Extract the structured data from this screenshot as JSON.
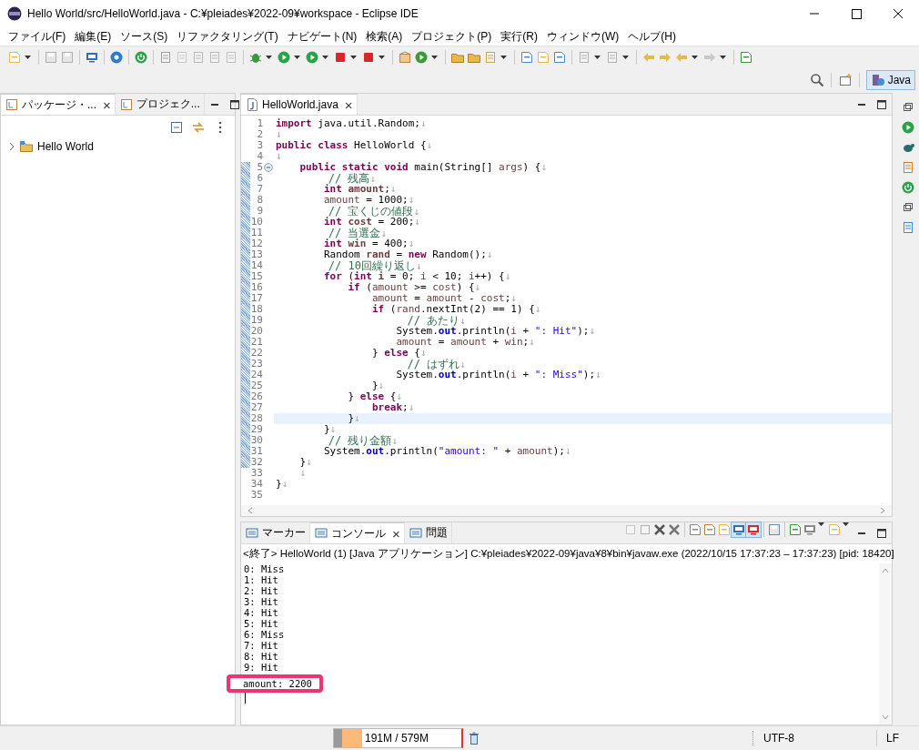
{
  "window": {
    "title": "Hello World/src/HelloWorld.java - C:¥pleiades¥2022-09¥workspace - Eclipse IDE"
  },
  "menu": [
    "ファイル(F)",
    "編集(E)",
    "ソース(S)",
    "リファクタリング(T)",
    "ナビゲート(N)",
    "検索(A)",
    "プロジェクト(P)",
    "実行(R)",
    "ウィンドウ(W)",
    "ヘルプ(H)"
  ],
  "perspective": {
    "label": "Java",
    "selected": true
  },
  "left_panel": {
    "tabs": [
      {
        "label": "パッケージ・...",
        "selected": true,
        "close": "×"
      },
      {
        "label": "プロジェク...",
        "selected": false
      }
    ],
    "tree": [
      {
        "label": "Hello World",
        "expanded": false
      }
    ]
  },
  "editor": {
    "tabs": [
      {
        "label": "HelloWorld.java",
        "selected": true,
        "close": "×"
      }
    ],
    "lines": [
      {
        "number": "1",
        "current": false,
        "changed": false,
        "foldable": false,
        "tokens": [
          {
            "kind": "kw",
            "text": "import"
          },
          {
            "kind": "plain",
            "text": " java.util.Random;"
          },
          {
            "kind": "eol",
            "text": "↓"
          }
        ]
      },
      {
        "number": "2",
        "current": false,
        "changed": false,
        "foldable": false,
        "tokens": [
          {
            "kind": "eol",
            "text": "↓"
          }
        ]
      },
      {
        "number": "3",
        "current": false,
        "changed": false,
        "foldable": false,
        "tokens": [
          {
            "kind": "kw",
            "text": "public class"
          },
          {
            "kind": "plain",
            "text": " HelloWorld {"
          },
          {
            "kind": "eol",
            "text": "↓"
          }
        ]
      },
      {
        "number": "4",
        "current": false,
        "changed": false,
        "foldable": false,
        "tokens": [
          {
            "kind": "eol",
            "text": "↓"
          }
        ]
      },
      {
        "number": "5",
        "current": false,
        "changed": true,
        "foldable": true,
        "tokens": [
          {
            "kind": "kw",
            "text": "    public static void"
          },
          {
            "kind": "plain",
            "text": " main(String[] "
          },
          {
            "kind": "var",
            "text": "args"
          },
          {
            "kind": "plain",
            "text": ") {"
          },
          {
            "kind": "eol",
            "text": "↓"
          }
        ]
      },
      {
        "number": "6",
        "current": false,
        "changed": true,
        "foldable": false,
        "tokens": [
          {
            "kind": "comment",
            "text": "        // 残高"
          },
          {
            "kind": "eol",
            "text": "↓"
          }
        ]
      },
      {
        "number": "7",
        "current": false,
        "changed": true,
        "foldable": false,
        "tokens": [
          {
            "kind": "kw",
            "text": "        int "
          },
          {
            "kind": "decl",
            "text": "amount"
          },
          {
            "kind": "plain",
            "text": ";"
          },
          {
            "kind": "eol",
            "text": "↓"
          }
        ]
      },
      {
        "number": "8",
        "current": false,
        "changed": true,
        "foldable": false,
        "tokens": [
          {
            "kind": "var",
            "text": "        amount"
          },
          {
            "kind": "plain",
            "text": " = 1000;"
          },
          {
            "kind": "eol",
            "text": "↓"
          }
        ]
      },
      {
        "number": "9",
        "current": false,
        "changed": true,
        "foldable": false,
        "tokens": [
          {
            "kind": "comment",
            "text": "        // 宝くじの値段"
          },
          {
            "kind": "eol",
            "text": "↓"
          }
        ]
      },
      {
        "number": "10",
        "current": false,
        "changed": true,
        "foldable": false,
        "tokens": [
          {
            "kind": "kw",
            "text": "        int "
          },
          {
            "kind": "decl",
            "text": "cost"
          },
          {
            "kind": "plain",
            "text": " = 200;"
          },
          {
            "kind": "eol",
            "text": "↓"
          }
        ]
      },
      {
        "number": "11",
        "current": false,
        "changed": true,
        "foldable": false,
        "tokens": [
          {
            "kind": "comment",
            "text": "        // 当選金"
          },
          {
            "kind": "eol",
            "text": "↓"
          }
        ]
      },
      {
        "number": "12",
        "current": false,
        "changed": true,
        "foldable": false,
        "tokens": [
          {
            "kind": "kw",
            "text": "        int "
          },
          {
            "kind": "decl",
            "text": "win"
          },
          {
            "kind": "plain",
            "text": " = 400;"
          },
          {
            "kind": "eol",
            "text": "↓"
          }
        ]
      },
      {
        "number": "13",
        "current": false,
        "changed": true,
        "foldable": false,
        "tokens": [
          {
            "kind": "plain",
            "text": "        Random "
          },
          {
            "kind": "decl",
            "text": "rand"
          },
          {
            "kind": "plain",
            "text": " = "
          },
          {
            "kind": "kw",
            "text": "new"
          },
          {
            "kind": "plain",
            "text": " Random();"
          },
          {
            "kind": "eol",
            "text": "↓"
          }
        ]
      },
      {
        "number": "14",
        "current": false,
        "changed": true,
        "foldable": false,
        "tokens": [
          {
            "kind": "comment",
            "text": "        // 10回繰り返し"
          },
          {
            "kind": "eol",
            "text": "↓"
          }
        ]
      },
      {
        "number": "15",
        "current": false,
        "changed": true,
        "foldable": false,
        "tokens": [
          {
            "kind": "kw",
            "text": "        for"
          },
          {
            "kind": "plain",
            "text": " ("
          },
          {
            "kind": "kw",
            "text": "int "
          },
          {
            "kind": "decl",
            "text": "i"
          },
          {
            "kind": "plain",
            "text": " = 0; "
          },
          {
            "kind": "var",
            "text": "i"
          },
          {
            "kind": "plain",
            "text": " < 10; "
          },
          {
            "kind": "var",
            "text": "i"
          },
          {
            "kind": "plain",
            "text": "++) {"
          },
          {
            "kind": "eol",
            "text": "↓"
          }
        ]
      },
      {
        "number": "16",
        "current": false,
        "changed": true,
        "foldable": false,
        "tokens": [
          {
            "kind": "kw",
            "text": "            if"
          },
          {
            "kind": "plain",
            "text": " ("
          },
          {
            "kind": "var",
            "text": "amount"
          },
          {
            "kind": "plain",
            "text": " >= "
          },
          {
            "kind": "var",
            "text": "cost"
          },
          {
            "kind": "plain",
            "text": ") {"
          },
          {
            "kind": "eol",
            "text": "↓"
          }
        ]
      },
      {
        "number": "17",
        "current": false,
        "changed": true,
        "foldable": false,
        "tokens": [
          {
            "kind": "var",
            "text": "                amount"
          },
          {
            "kind": "plain",
            "text": " = "
          },
          {
            "kind": "var",
            "text": "amount"
          },
          {
            "kind": "plain",
            "text": " - "
          },
          {
            "kind": "var",
            "text": "cost"
          },
          {
            "kind": "plain",
            "text": ";"
          },
          {
            "kind": "eol",
            "text": "↓"
          }
        ]
      },
      {
        "number": "18",
        "current": false,
        "changed": true,
        "foldable": false,
        "tokens": [
          {
            "kind": "kw",
            "text": "                if"
          },
          {
            "kind": "plain",
            "text": " ("
          },
          {
            "kind": "var",
            "text": "rand"
          },
          {
            "kind": "plain",
            "text": ".nextInt(2) == 1) {"
          },
          {
            "kind": "eol",
            "text": "↓"
          }
        ]
      },
      {
        "number": "19",
        "current": false,
        "changed": true,
        "foldable": false,
        "tokens": [
          {
            "kind": "comment",
            "text": "                    // あたり"
          },
          {
            "kind": "eol",
            "text": "↓"
          }
        ]
      },
      {
        "number": "20",
        "current": false,
        "changed": true,
        "foldable": false,
        "tokens": [
          {
            "kind": "plain",
            "text": "                    System."
          },
          {
            "kind": "field",
            "text": "out"
          },
          {
            "kind": "plain",
            "text": ".println("
          },
          {
            "kind": "var",
            "text": "i"
          },
          {
            "kind": "plain",
            "text": " + "
          },
          {
            "kind": "string",
            "text": "\": Hit\""
          },
          {
            "kind": "plain",
            "text": ");"
          },
          {
            "kind": "eol",
            "text": "↓"
          }
        ]
      },
      {
        "number": "21",
        "current": false,
        "changed": true,
        "foldable": false,
        "tokens": [
          {
            "kind": "var",
            "text": "                    amount"
          },
          {
            "kind": "plain",
            "text": " = "
          },
          {
            "kind": "var",
            "text": "amount"
          },
          {
            "kind": "plain",
            "text": " + "
          },
          {
            "kind": "var",
            "text": "win"
          },
          {
            "kind": "plain",
            "text": ";"
          },
          {
            "kind": "eol",
            "text": "↓"
          }
        ]
      },
      {
        "number": "22",
        "current": false,
        "changed": true,
        "foldable": false,
        "tokens": [
          {
            "kind": "plain",
            "text": "                } "
          },
          {
            "kind": "kw",
            "text": "else"
          },
          {
            "kind": "plain",
            "text": " {"
          },
          {
            "kind": "eol",
            "text": "↓"
          }
        ]
      },
      {
        "number": "23",
        "current": false,
        "changed": true,
        "foldable": false,
        "tokens": [
          {
            "kind": "comment",
            "text": "                    // はずれ"
          },
          {
            "kind": "eol",
            "text": "↓"
          }
        ]
      },
      {
        "number": "24",
        "current": false,
        "changed": true,
        "foldable": false,
        "tokens": [
          {
            "kind": "plain",
            "text": "                    System."
          },
          {
            "kind": "field",
            "text": "out"
          },
          {
            "kind": "plain",
            "text": ".println("
          },
          {
            "kind": "var",
            "text": "i"
          },
          {
            "kind": "plain",
            "text": " + "
          },
          {
            "kind": "string",
            "text": "\": Miss\""
          },
          {
            "kind": "plain",
            "text": ");"
          },
          {
            "kind": "eol",
            "text": "↓"
          }
        ]
      },
      {
        "number": "25",
        "current": false,
        "changed": true,
        "foldable": false,
        "tokens": [
          {
            "kind": "plain",
            "text": "                }"
          },
          {
            "kind": "eol",
            "text": "↓"
          }
        ]
      },
      {
        "number": "26",
        "current": false,
        "changed": true,
        "foldable": false,
        "tokens": [
          {
            "kind": "plain",
            "text": "            } "
          },
          {
            "kind": "kw",
            "text": "else"
          },
          {
            "kind": "plain",
            "text": " {"
          },
          {
            "kind": "eol",
            "text": "↓"
          }
        ]
      },
      {
        "number": "27",
        "current": false,
        "changed": true,
        "foldable": false,
        "tokens": [
          {
            "kind": "kw",
            "text": "                break"
          },
          {
            "kind": "plain",
            "text": ";"
          },
          {
            "kind": "eol",
            "text": "↓"
          }
        ]
      },
      {
        "number": "28",
        "current": true,
        "changed": true,
        "foldable": false,
        "tokens": [
          {
            "kind": "plain",
            "text": "            }"
          },
          {
            "kind": "eol",
            "text": "↓"
          }
        ]
      },
      {
        "number": "29",
        "current": false,
        "changed": true,
        "foldable": false,
        "tokens": [
          {
            "kind": "plain",
            "text": "        }"
          },
          {
            "kind": "eol",
            "text": "↓"
          }
        ]
      },
      {
        "number": "30",
        "current": false,
        "changed": true,
        "foldable": false,
        "tokens": [
          {
            "kind": "comment",
            "text": "        // 残り金額"
          },
          {
            "kind": "eol",
            "text": "↓"
          }
        ]
      },
      {
        "number": "31",
        "current": false,
        "changed": true,
        "foldable": false,
        "tokens": [
          {
            "kind": "plain",
            "text": "        System."
          },
          {
            "kind": "field",
            "text": "out"
          },
          {
            "kind": "plain",
            "text": ".println("
          },
          {
            "kind": "string",
            "text": "\"amount: \""
          },
          {
            "kind": "plain",
            "text": " + "
          },
          {
            "kind": "var",
            "text": "amount"
          },
          {
            "kind": "plain",
            "text": ");"
          },
          {
            "kind": "eol",
            "text": "↓"
          }
        ]
      },
      {
        "number": "32",
        "current": false,
        "changed": true,
        "foldable": false,
        "tokens": [
          {
            "kind": "plain",
            "text": "    }"
          },
          {
            "kind": "eol",
            "text": "↓"
          }
        ]
      },
      {
        "number": "33",
        "current": false,
        "changed": false,
        "foldable": false,
        "tokens": [
          {
            "kind": "eol",
            "text": "    ↓"
          }
        ]
      },
      {
        "number": "34",
        "current": false,
        "changed": false,
        "foldable": false,
        "tokens": [
          {
            "kind": "plain",
            "text": "}"
          },
          {
            "kind": "eol",
            "text": "↓"
          }
        ]
      },
      {
        "number": "35",
        "current": false,
        "changed": false,
        "foldable": false
      }
    ]
  },
  "console": {
    "tabs": [
      {
        "label": "マーカー",
        "selected": false
      },
      {
        "label": "コンソール",
        "selected": true,
        "close": "×"
      },
      {
        "label": "問題",
        "selected": false
      }
    ],
    "header": "<終了> HelloWorld (1) [Java アプリケーション] C:¥pleiades¥2022-09¥java¥8¥bin¥javaw.exe  (2022/10/15 17:37:23 – 17:37:23) [pid: 18420]",
    "lines": [
      {
        "text": "0: Miss",
        "highlighted": false
      },
      {
        "text": "1: Hit",
        "highlighted": false
      },
      {
        "text": "2: Hit",
        "highlighted": false
      },
      {
        "text": "3: Hit",
        "highlighted": false
      },
      {
        "text": "4: Hit",
        "highlighted": false
      },
      {
        "text": "5: Hit",
        "highlighted": false
      },
      {
        "text": "6: Miss",
        "highlighted": false
      },
      {
        "text": "7: Hit",
        "highlighted": false
      },
      {
        "text": "8: Hit",
        "highlighted": false
      },
      {
        "text": "9: Hit",
        "highlighted": false
      },
      {
        "text": "amount: 2200",
        "highlighted": true
      }
    ]
  },
  "status_bar": {
    "memory": {
      "text": "191M / 579M",
      "level": 0.22
    },
    "encoding": "UTF-8",
    "line_ending": "LF"
  }
}
